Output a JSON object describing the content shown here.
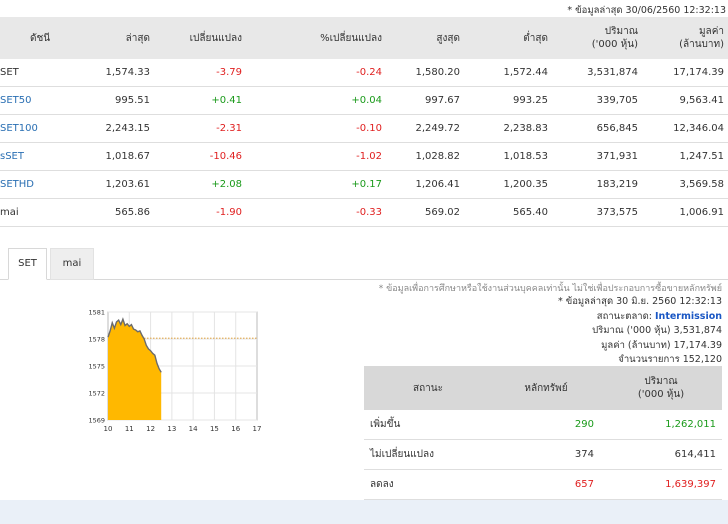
{
  "update_note": "* ข้อมูลล่าสุด 30/06/2560 12:32:13",
  "index_table": {
    "headers": {
      "name": "ดัชนี",
      "last": "ล่าสุด",
      "change": "เปลี่ยนแปลง",
      "pct_change": "%เปลี่ยนแปลง",
      "high": "สูงสุด",
      "low": "ต่ำสุด",
      "volume_1": "ปริมาณ",
      "volume_2": "('000 หุ้น)",
      "value_1": "มูลค่า",
      "value_2": "(ล้านบาท)"
    },
    "rows": [
      {
        "name": "SET",
        "last": "1,574.33",
        "change": "-3.79",
        "pct": "-0.24",
        "high": "1,580.20",
        "low": "1,572.44",
        "volume": "3,531,874",
        "value": "17,174.39"
      },
      {
        "name": "SET50",
        "last": "995.51",
        "change": "+0.41",
        "pct": "+0.04",
        "high": "997.67",
        "low": "993.25",
        "volume": "339,705",
        "value": "9,563.41"
      },
      {
        "name": "SET100",
        "last": "2,243.15",
        "change": "-2.31",
        "pct": "-0.10",
        "high": "2,249.72",
        "low": "2,238.83",
        "volume": "656,845",
        "value": "12,346.04"
      },
      {
        "name": "sSET",
        "last": "1,018.67",
        "change": "-10.46",
        "pct": "-1.02",
        "high": "1,028.82",
        "low": "1,018.53",
        "volume": "371,931",
        "value": "1,247.51"
      },
      {
        "name": "SETHD",
        "last": "1,203.61",
        "change": "+2.08",
        "pct": "+0.17",
        "high": "1,206.41",
        "low": "1,200.35",
        "volume": "183,219",
        "value": "3,569.58"
      },
      {
        "name": "mai",
        "last": "565.86",
        "change": "-1.90",
        "pct": "-0.33",
        "high": "569.02",
        "low": "565.40",
        "volume": "373,575",
        "value": "1,006.91"
      }
    ]
  },
  "tabs": [
    {
      "label": "SET",
      "active": true
    },
    {
      "label": "mai",
      "active": false
    }
  ],
  "colors": {
    "positive": "#1a9a1a",
    "negative": "#e02020",
    "link": "#2a6fb3",
    "chart_fill": "#ffb800",
    "header_bg": "#e8e8e8",
    "status_highlight": "#1a57c4"
  },
  "chart_data": {
    "type": "area",
    "title": "",
    "xlabel": "",
    "ylabel": "",
    "xlim": [
      10,
      17
    ],
    "ylim": [
      1569,
      1581
    ],
    "x_ticks": [
      "10",
      "11",
      "12",
      "13",
      "14",
      "15",
      "16",
      "17"
    ],
    "y_ticks": [
      "1581",
      "1578",
      "1575",
      "1572",
      "1569"
    ],
    "reference_line": 1578.1,
    "grid": true,
    "x": [
      10.0,
      10.1,
      10.2,
      10.3,
      10.4,
      10.5,
      10.6,
      10.7,
      10.8,
      10.9,
      11.0,
      11.1,
      11.2,
      11.3,
      11.4,
      11.5,
      11.6,
      11.7,
      11.8,
      11.9,
      12.0,
      12.1,
      12.2,
      12.3,
      12.4,
      12.5
    ],
    "y": [
      1578.2,
      1578.9,
      1579.8,
      1579.2,
      1579.9,
      1580.1,
      1579.6,
      1580.2,
      1579.5,
      1579.7,
      1579.4,
      1579.6,
      1579.1,
      1579.0,
      1578.8,
      1578.9,
      1578.4,
      1578.0,
      1577.3,
      1576.9,
      1576.7,
      1576.4,
      1576.2,
      1575.3,
      1574.7,
      1574.3
    ]
  },
  "chart_disclaimer": "* ข้อมูลเพื่อการศึกษาหรือใช้งานส่วนบุคคลเท่านั้น ไม่ใช่เพื่อประกอบการซื้อขายหลักทรัพย์",
  "market_info": {
    "updated": "* ข้อมูลล่าสุด 30 มิ.ย. 2560 12:32:13",
    "status_label": "สถานะตลาด:",
    "status_value": "Intermission",
    "volume_label": "ปริมาณ ('000 หุ้น)",
    "volume_value": "3,531,874",
    "value_label": "มูลค่า (ล้านบาท)",
    "value_value": "17,174.39",
    "trades_label": "จำนวนรายการ",
    "trades_value": "152,120"
  },
  "advance_decline": {
    "headers": {
      "status": "สถานะ",
      "securities": "หลักทรัพย์",
      "volume_1": "ปริมาณ",
      "volume_2": "('000 หุ้น)"
    },
    "rows": [
      {
        "status": "เพิ่มขึ้น",
        "securities": "290",
        "volume": "1,262,011",
        "tone": "pos"
      },
      {
        "status": "ไม่เปลี่ยนแปลง",
        "securities": "374",
        "volume": "614,411",
        "tone": "neutral"
      },
      {
        "status": "ลดลง",
        "securities": "657",
        "volume": "1,639,397",
        "tone": "neg"
      }
    ]
  }
}
